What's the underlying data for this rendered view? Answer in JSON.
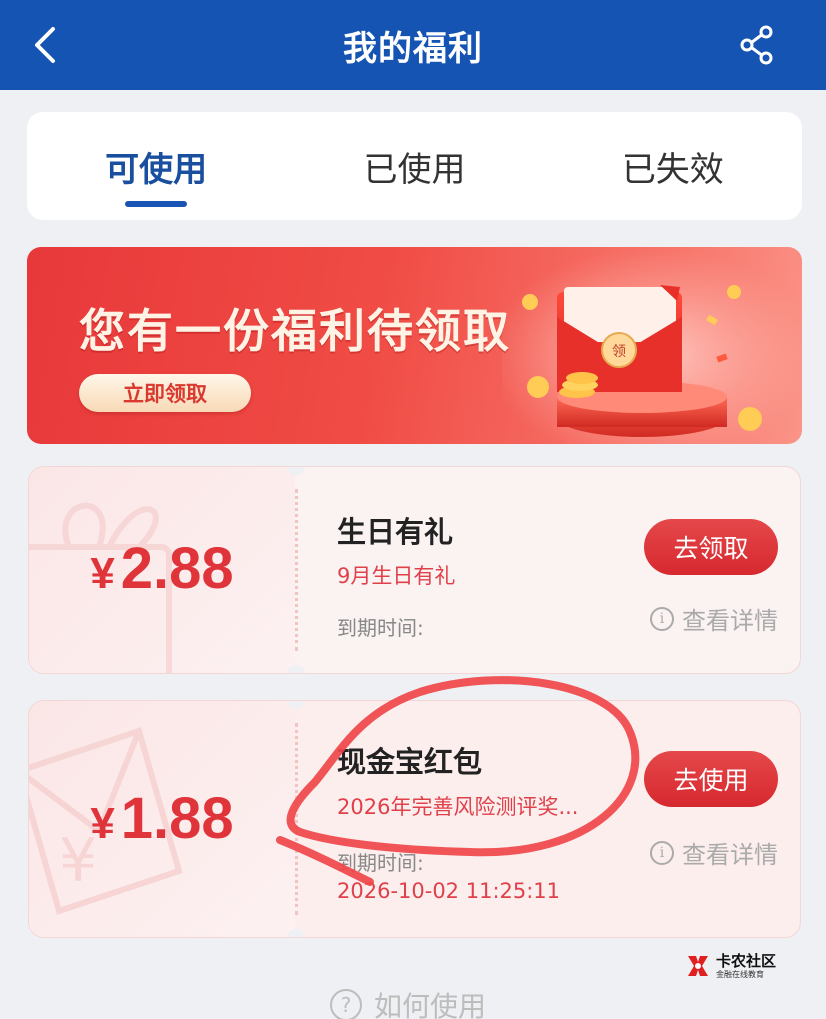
{
  "header": {
    "title": "我的福利",
    "back_icon": "chevron-left-icon",
    "share_icon": "share-icon",
    "bg_color": "#1554b3"
  },
  "tabs": [
    {
      "label": "可使用",
      "active": true
    },
    {
      "label": "已使用",
      "active": false
    },
    {
      "label": "已失效",
      "active": false
    }
  ],
  "banner": {
    "title": "您有一份福利待领取",
    "button_label": "立即领取",
    "envelope_glyph": "领"
  },
  "coupons": [
    {
      "currency": "¥",
      "amount": "2.88",
      "title": "生日有礼",
      "subtitle": "9月生日有礼",
      "expiry_label": "到期时间:",
      "expiry_value": "",
      "action_label": "去领取",
      "details_label": "查看详情"
    },
    {
      "currency": "¥",
      "amount": "1.88",
      "title": "现金宝红包",
      "subtitle": "2026年完善风险测评奖...",
      "expiry_label": "到期时间:",
      "expiry_value": "2026-10-02 11:25:11",
      "action_label": "去使用",
      "details_label": "查看详情"
    }
  ],
  "watermark": {
    "main": "卡农社区",
    "sub": "金融在线教育"
  },
  "footer": {
    "howto_label": "如何使用"
  },
  "colors": {
    "accent_red": "#e0343b",
    "tab_active": "#1a4fa0"
  }
}
